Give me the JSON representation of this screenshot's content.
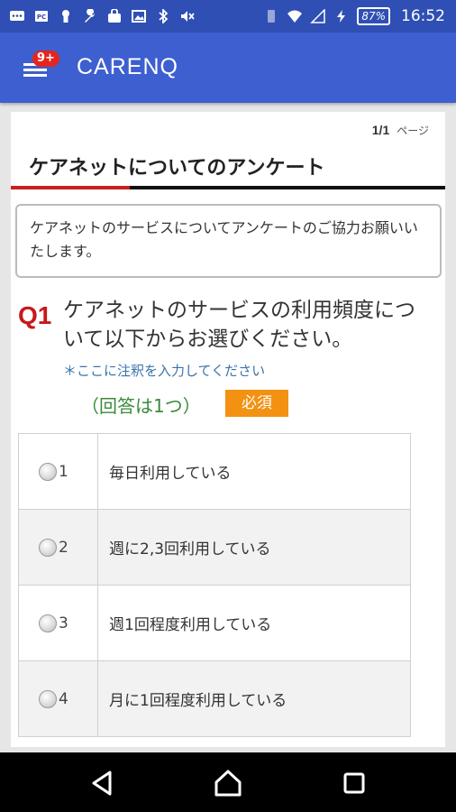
{
  "status_bar": {
    "battery": "87%",
    "time": "16:52",
    "icons": [
      "message-icon",
      "pc-icon",
      "keyhole-icon",
      "wrench-icon",
      "lock-bag-icon",
      "image-icon",
      "bluetooth-icon",
      "mute-icon",
      "vibrate-icon",
      "wifi-icon",
      "signal-icon",
      "charging-icon"
    ]
  },
  "app_bar": {
    "badge": "9+",
    "title": "CARENQ"
  },
  "survey": {
    "page_current": "1/1",
    "page_unit": "ページ",
    "title": "ケアネットについてのアンケート",
    "intro": "ケアネットのサービスについてアンケートのご協力お願いいたします。",
    "question": {
      "number": "Q1",
      "text": "ケアネットのサービスの利用頻度について以下からお選びください。",
      "note": "＊ここに注釈を入力してください",
      "answer_count": "（回答は1つ）",
      "required_label": "必須",
      "options": [
        {
          "num": "1",
          "label": "毎日利用している"
        },
        {
          "num": "2",
          "label": "週に2,3回利用している"
        },
        {
          "num": "3",
          "label": "週1回程度利用している"
        },
        {
          "num": "4",
          "label": "月に1回程度利用している"
        }
      ]
    }
  },
  "colors": {
    "status_bar": "#2f4fb5",
    "app_bar": "#3d5fd0",
    "question_number": "#c8181c",
    "note": "#3a74a8",
    "answer_count": "#3a8a3a",
    "required_badge": "#f39112"
  }
}
